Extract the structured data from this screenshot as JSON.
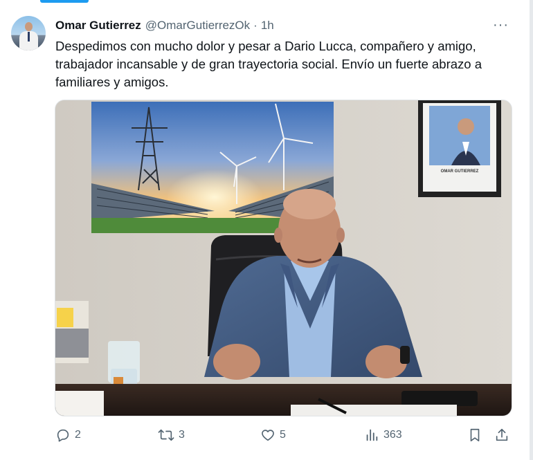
{
  "tweet": {
    "author_name": "Omar Gutierrez",
    "handle": "@OmarGutierrezOk",
    "separator": "·",
    "time": "1h",
    "more": "···",
    "text": "Despedimos con mucho dolor y pesar a Dario Lucca, compañero y amigo, trabajador incansable y de gran trayectoria social. Envío un fuerte abrazo a familiares y amigos."
  },
  "media": {
    "frame_caption": "OMAR GUTIERREZ"
  },
  "actions": {
    "replies": "2",
    "reposts": "3",
    "likes": "5",
    "views": "363"
  },
  "icons": [
    "reply-icon",
    "repost-icon",
    "like-icon",
    "views-icon",
    "bookmark-icon",
    "share-icon"
  ],
  "colors": {
    "accent": "#1d9bf0",
    "secondary_text": "#536471"
  }
}
